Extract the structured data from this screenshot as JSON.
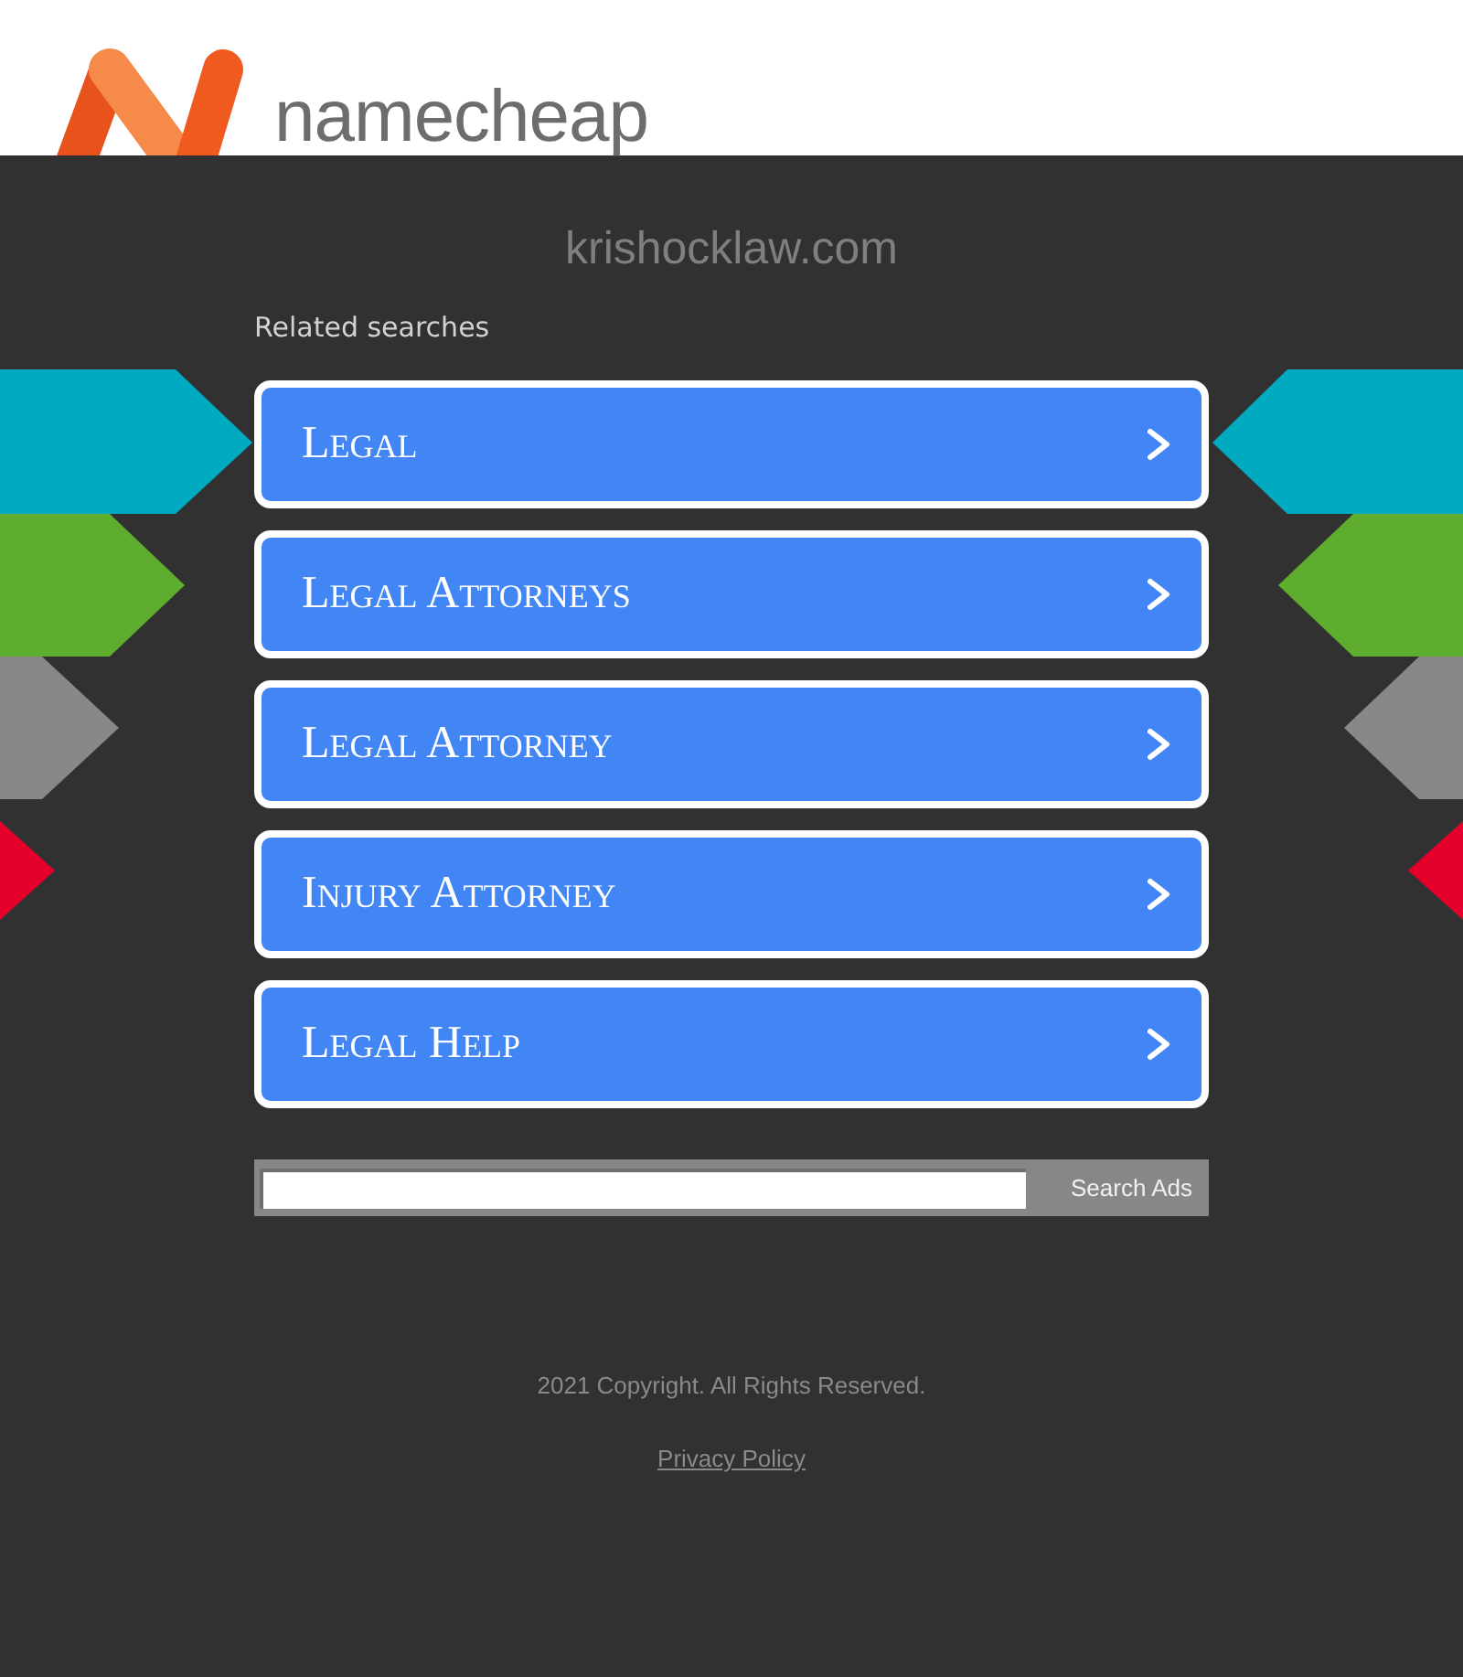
{
  "header": {
    "logo_text": "namecheap"
  },
  "domain": "krishocklaw.com",
  "related": {
    "title": "Related searches",
    "links": [
      "Legal",
      "Legal Attorneys",
      "Legal Attorney",
      "Injury Attorney",
      "Legal Help"
    ]
  },
  "search": {
    "button": "Search Ads"
  },
  "footer": {
    "copyright": "2021 Copyright. All Rights Reserved.",
    "privacy_link": "Privacy Policy"
  }
}
